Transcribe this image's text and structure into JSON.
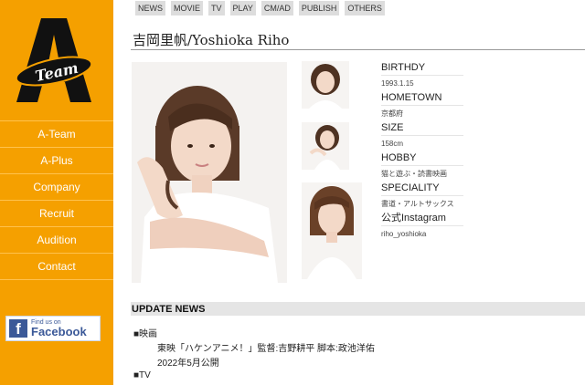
{
  "sidebar": {
    "logo_letter": "A",
    "logo_script": "Team",
    "nav": [
      "A-Team",
      "A-Plus",
      "Company",
      "Recruit",
      "Audition",
      "Contact"
    ],
    "facebook": {
      "icon": "f",
      "line1": "Find us on",
      "line2": "Facebook"
    }
  },
  "tabs": [
    "NEWS",
    "MOVIE",
    "TV",
    "PLAY",
    "CM/AD",
    "PUBLISH",
    "OTHERS"
  ],
  "title": "吉岡里帆/Yoshioka Riho",
  "profile": [
    {
      "label": "BIRTHDY",
      "value": "1993.1.15"
    },
    {
      "label": "HOMETOWN",
      "value": "京都府"
    },
    {
      "label": "SIZE",
      "value": "158cm"
    },
    {
      "label": "HOBBY",
      "value": "猫と遊ぶ・読書映画"
    },
    {
      "label": "SPECIALITY",
      "value": "書道・アルトサックス"
    },
    {
      "label": "公式Instagram",
      "value": "riho_yoshioka"
    }
  ],
  "news": {
    "title": "UPDATE NEWS",
    "category1": "■映画",
    "item1": "東映「ハケンアニメ！」監督:吉野耕平 脚本:政池洋佑",
    "item1_date": "2022年5月公開",
    "category2": "■TV"
  },
  "colors": {
    "sidebar": "#f5a000",
    "facebook": "#3b5998",
    "tab": "#dddddd",
    "news_bar": "#e5e5e5"
  }
}
